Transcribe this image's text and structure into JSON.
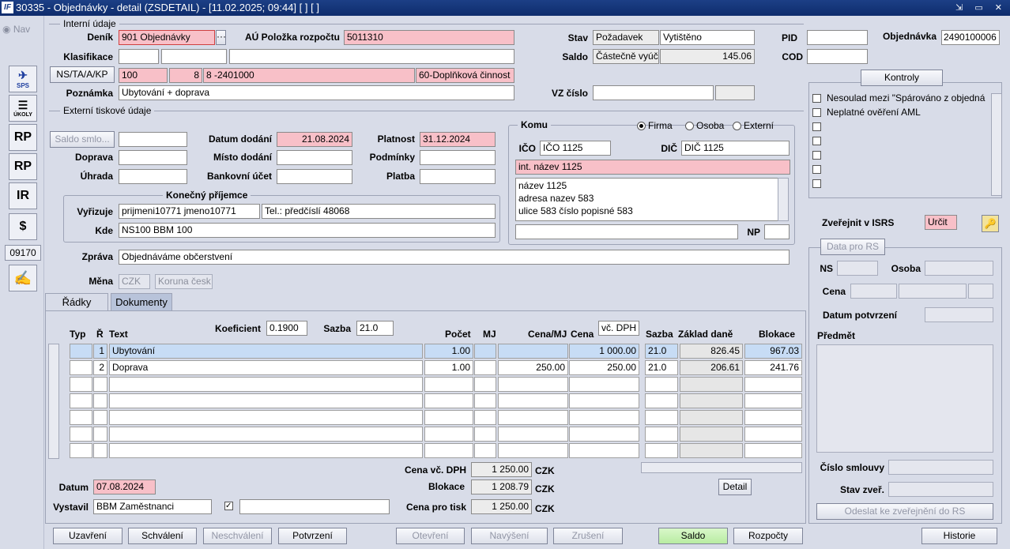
{
  "window": {
    "title": "30335 - Objednávky - detail (ZSDETAIL) - [11.02.2025; 09:44]  [ ]  [ ]",
    "logo": "IF",
    "controls": "⇲ ▭ ✕"
  },
  "sidebar": {
    "nav": "Nav",
    "items": [
      "SPS",
      "ÚKOLY",
      "RP",
      "RP",
      "IR",
      "$"
    ],
    "code": "09170"
  },
  "internal": {
    "section": "Interní údaje",
    "denik_label": "Deník",
    "denik": "901 Objednávky",
    "au_label": "AÚ Položka rozpočtu",
    "au": "5011310",
    "stav_label": "Stav",
    "stav": "Požadavek",
    "stav2": "Vytištěno",
    "pid_label": "PID",
    "pid": "",
    "objednavka_label": "Objednávka",
    "objednavka": "2490100006",
    "klasifikace_label": "Klasifikace",
    "saldo_label": "Saldo",
    "saldo_text": "Částečně vyúč",
    "saldo_value": "145.06",
    "cod_label": "COD",
    "ns_btn": "NS/TA/A/KP",
    "ns": "100",
    "ta": "8",
    "a": "8 -2401000",
    "kp": "60-Doplňková činnost",
    "poznamka_label": "Poznámka",
    "poznamka": "Ubytování + doprava",
    "vz_label": "VZ číslo"
  },
  "external": {
    "section": "Externí tiskové údaje",
    "saldo_btn": "Saldo smlo...",
    "datum_dodani_label": "Datum dodání",
    "datum_dodani": "21.08.2024",
    "platnost_label": "Platnost",
    "platnost": "31.12.2024",
    "doprava_label": "Doprava",
    "misto_label": "Místo dodání",
    "podminky_label": "Podmínky",
    "uhrada_label": "Úhrada",
    "bank_label": "Bankovní účet",
    "platba_label": "Platba"
  },
  "recipient": {
    "title": "Konečný příjemce",
    "vyrizuje_label": "Vyřizuje",
    "vyrizuje": "prijmeni10771 jmeno10771",
    "tel": "Tel.: předčíslí 48068",
    "kde_label": "Kde",
    "kde": "NS100 BBM 100"
  },
  "komu": {
    "title": "Komu",
    "r_firma": "Firma",
    "r_osoba": "Osoba",
    "r_externi": "Externí",
    "ico_label": "IČO",
    "ico": "IČO 1125",
    "dic_label": "DIČ",
    "dic": "DIČ 1125",
    "int_name": "int. název 1125",
    "addr1": "název 1125",
    "addr2": "adresa nazev 583",
    "addr3": "ulice 583 číslo popisné 583",
    "np_label": "NP"
  },
  "zprava": {
    "label": "Zpráva",
    "value": "Objednáváme občerstvení",
    "mena_label": "Měna",
    "mena": "CZK",
    "mena_name": "Koruna česk"
  },
  "tabs": {
    "radky": "Řádky",
    "dokumenty": "Dokumenty"
  },
  "grid": {
    "koef_label": "Koeficient",
    "koef": "0.1900",
    "sazba_label": "Sazba",
    "sazba": "21.0",
    "cena_sel": "vč. DPH",
    "headers": {
      "typ": "Typ",
      "r": "Ř",
      "text": "Text",
      "pocet": "Počet",
      "mj": "MJ",
      "cena_mj": "Cena/MJ",
      "cena": "Cena",
      "sazba": "Sazba",
      "zaklad": "Základ daně",
      "blokace": "Blokace"
    },
    "rows": [
      {
        "typ": "",
        "r": "1",
        "text": "Ubytování",
        "pocet": "1.00",
        "mj": "",
        "cena_mj": "",
        "cena": "1 000.00",
        "sazba": "21.0",
        "zaklad": "826.45",
        "blokace": "967.03"
      },
      {
        "typ": "",
        "r": "2",
        "text": "Doprava",
        "pocet": "1.00",
        "mj": "",
        "cena_mj": "250.00",
        "cena": "250.00",
        "sazba": "21.0",
        "zaklad": "206.61",
        "blokace": "241.76"
      }
    ]
  },
  "totals": {
    "cena_dph_label": "Cena vč. DPH",
    "cena_dph": "1 250.00",
    "blokace_label": "Blokace",
    "blokace": "1 208.79",
    "tisk_label": "Cena pro tisk",
    "tisk": "1 250.00",
    "currency": "CZK",
    "detail_btn": "Detail"
  },
  "bottom": {
    "datum_label": "Datum",
    "datum": "07.08.2024",
    "vystavil_label": "Vystavil",
    "vystavil": "BBM Zaměstnanci"
  },
  "buttons": {
    "uzavreni": "Uzavření",
    "schvaleni": "Schválení",
    "neschvaleni": "Neschválení",
    "potvrzeni": "Potvrzení",
    "otevreni": "Otevření",
    "navyseni": "Navýšení",
    "zruseni": "Zrušení",
    "saldo": "Saldo",
    "rozpocty": "Rozpočty",
    "historie": "Historie"
  },
  "kontroly": {
    "btn": "Kontroly",
    "items": [
      "Nesoulad mezi \"Spárováno z objedná",
      "Neplatné ověření AML"
    ]
  },
  "rs": {
    "zverejnit_label": "Zveřejnit v ISRS",
    "zverejnit": "Určit",
    "data_btn": "Data pro RS",
    "ns_label": "NS",
    "osoba_label": "Osoba",
    "cena_label": "Cena",
    "datum_label": "Datum potvrzení",
    "predmet_label": "Předmět",
    "cislo_label": "Číslo smlouvy",
    "stav_label": "Stav zveř.",
    "odeslat": "Odeslat ke zveřejnění do RS"
  },
  "colors": {
    "title_bar": "#1c3f86",
    "pink_field": "#f8c0c8",
    "selected_row": "#c7dcf5",
    "saldo_green": "#b8eca2"
  }
}
